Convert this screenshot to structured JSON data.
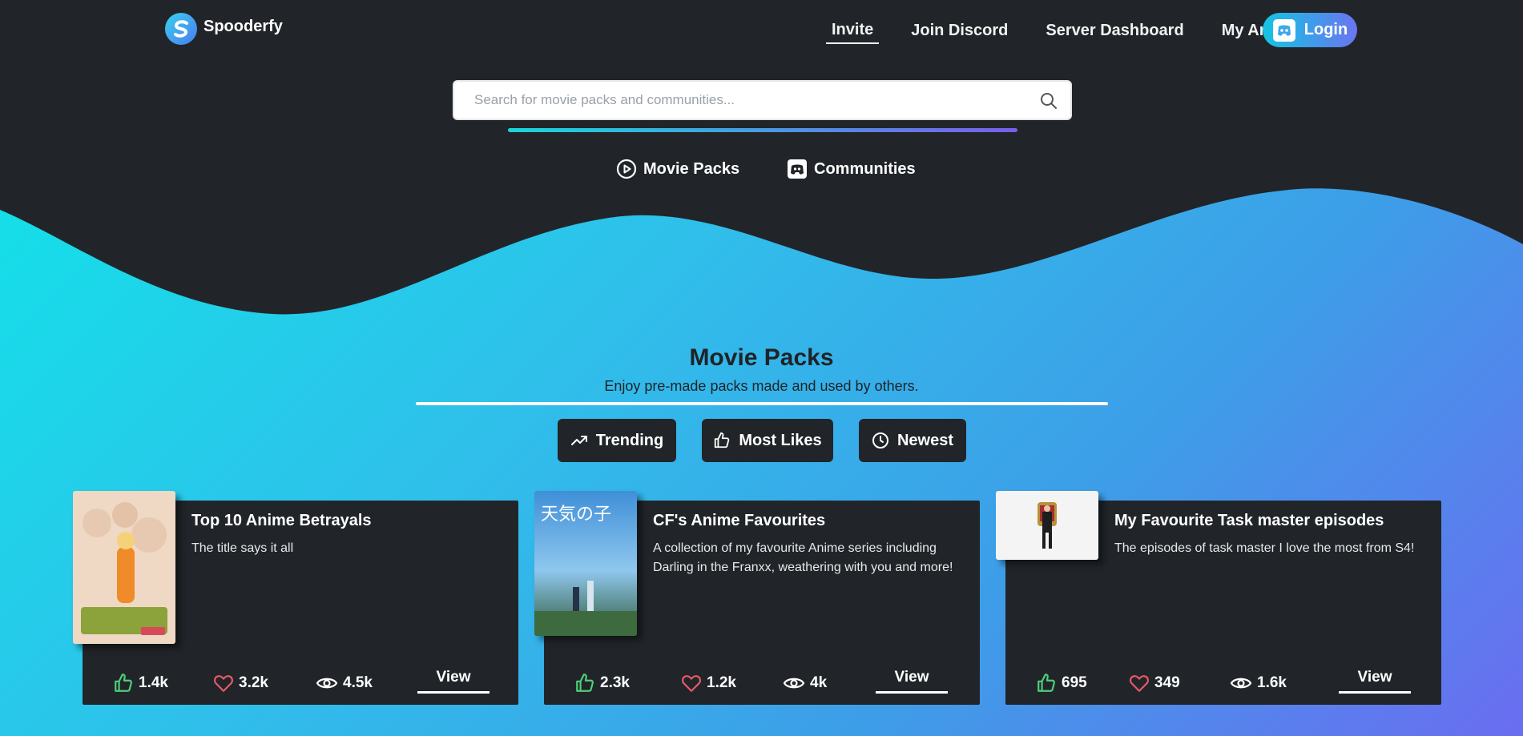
{
  "nav": {
    "brand": "Spooderfy",
    "links": [
      "Invite",
      "Join Discord",
      "Server Dashboard",
      "My Area"
    ],
    "login": "Login"
  },
  "search": {
    "placeholder": "Search for movie packs and communities..."
  },
  "tabs": {
    "movie_packs": "Movie Packs",
    "communities": "Communities"
  },
  "section": {
    "title": "Movie Packs",
    "subtitle": "Enjoy pre-made packs made and used by others."
  },
  "filters": {
    "trending": "Trending",
    "most_likes": "Most Likes",
    "newest": "Newest"
  },
  "cards": [
    {
      "title": "Top 10 Anime Betrayals",
      "description": "The title says it all",
      "likes": "1.4k",
      "hearts": "3.2k",
      "views": "4.5k",
      "view": "View"
    },
    {
      "title": "CF's Anime Favourites",
      "description": "A collection of my favourite Anime series including Darling in the Franxx, weathering with you and more!",
      "likes": "2.3k",
      "hearts": "1.2k",
      "views": "4k",
      "view": "View",
      "poster_text": "天気の子"
    },
    {
      "title": "My Favourite Task master episodes",
      "description": "The episodes of task master I love the most from S4!",
      "likes": "695",
      "hearts": "349",
      "views": "1.6k",
      "view": "View"
    }
  ],
  "colors": {
    "dark": "#212529",
    "accent_start": "#0de8e8",
    "accent_end": "#6a6df0",
    "like": "#4fd07a",
    "heart": "#e85a6a"
  }
}
